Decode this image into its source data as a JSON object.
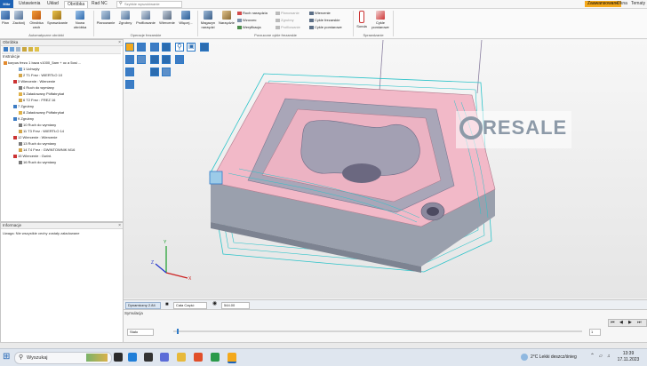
{
  "menubar": {
    "app_logo": "Mikr",
    "tabs": [
      "Ustawienia",
      "Układ",
      "Obróbka",
      "Rad NC"
    ],
    "active_tab": "Obróbka",
    "search_placeholder": "Szybkie wyszukiwanie",
    "right_items": [
      "Zaawansowane",
      "Okna",
      "Tematy",
      "Styl"
    ],
    "active_mode": "Zaawansowane"
  },
  "ribbon": {
    "group1": {
      "name": "Automatyczne obróbki",
      "buttons": [
        "Plan",
        "Zaciśnij",
        "Obróbka cech",
        "Sprawdzanie",
        "Nowa obróbka"
      ]
    },
    "group2": {
      "name": "Operacje frezarskie",
      "buttons": [
        "Planowanie",
        "Zgrubny",
        "Profilowanie",
        "Wiercenie",
        "Więcej..."
      ]
    },
    "group3": {
      "name": "Porzucone cykle frezarskie",
      "buttons": [
        "Magazyn narzędzi",
        "Narzędzie"
      ],
      "col1": [
        "Ruch narzędzia",
        "Wzorzec",
        "Weryfikacja"
      ],
      "col2": [
        "Planowanie",
        "Zgrubny",
        "Profilowanie"
      ],
      "col3": [
        "Wiercenie",
        "Cykle frezarskie",
        "Cykle pomiarowe"
      ]
    },
    "group4": {
      "name": "Sprawdzanie",
      "buttons": [
        "Sonda",
        "Cykle pomiarowe"
      ]
    }
  },
  "left_panel": {
    "title": "Obróbka",
    "subtitle": "Instrukcje",
    "tree": [
      "korpus frezu 1 baza v1000_5am + oc a 5osi ...",
      "1 Uchwyty",
      "2 T1 Frez : WIERTŁO 10",
      "3 Wiercenie : Wiercenie",
      "4 Ruch do wymiany",
      "5 Załadowany Półfabrykat",
      "6 T2 Frez : FREZ 16",
      "7 Zgrubny",
      "8 Załadowany Półfabrykat",
      "9 Zgrubny",
      "10 Ruch do wymiany",
      "11 T3 Frez : WIERTŁO 14",
      "12 Wiercenie : Wiercenie",
      "13 Ruch do wymiany",
      "14 T4 Frez : GWINTOWNIK M16",
      "15 Wiercenie : Gwint.",
      "16 Ruch do wymiany"
    ]
  },
  "info_panel": {
    "title": "Informacje",
    "message": "Uwaga: Nie wszystkie cechy zostały załadowane"
  },
  "viewport": {
    "watermark": "RESALE"
  },
  "view_status": {
    "mode": "Dynamiczny 2.84",
    "part": "Cała Część",
    "value": "544.00"
  },
  "simulation": {
    "title": "Symulacja",
    "state": "Stało",
    "step": "1"
  },
  "taskbar": {
    "search": "Wyszukaj",
    "weather": "2°C  Lekki deszcz/śnieg",
    "time": "13:39",
    "date": "17.11.2023"
  },
  "colors": {
    "accent": "#f4a91c",
    "part": "#f2b9c8",
    "toolpath": "#2bc3c9",
    "brand_blue": "#1e63b5"
  }
}
